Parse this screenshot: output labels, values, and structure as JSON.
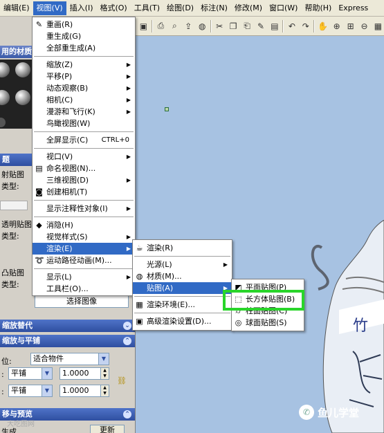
{
  "menubar": {
    "items": [
      "编辑(E)",
      "视图(V)",
      "插入(I)",
      "格式(O)",
      "工具(T)",
      "绘图(D)",
      "标注(N)",
      "修改(M)",
      "窗口(W)",
      "帮助(H)",
      "Express"
    ]
  },
  "view_menu": {
    "items": [
      {
        "label": "重画(R)"
      },
      {
        "label": "重生成(G)"
      },
      {
        "label": "全部重生成(A)"
      },
      {
        "label": "缩放(Z)"
      },
      {
        "label": "平移(P)"
      },
      {
        "label": "动态观察(B)"
      },
      {
        "label": "相机(C)"
      },
      {
        "label": "漫游和飞行(K)"
      },
      {
        "label": "鸟瞰视图(W)"
      },
      {
        "label": "全屏显示(C)",
        "shortcut": "CTRL+0"
      },
      {
        "label": "视口(V)"
      },
      {
        "label": "命名视图(N)..."
      },
      {
        "label": "三维视图(D)"
      },
      {
        "label": "创建相机(T)"
      },
      {
        "label": "显示注释性对象(I)"
      },
      {
        "label": "消隐(H)"
      },
      {
        "label": "视觉样式(S)"
      },
      {
        "label": "渲染(E)"
      },
      {
        "label": "运动路径动画(M)..."
      },
      {
        "label": "显示(L)"
      },
      {
        "label": "工具栏(O)..."
      }
    ]
  },
  "render_menu": {
    "items": [
      {
        "label": "渲染(R)"
      },
      {
        "label": "光源(L)"
      },
      {
        "label": "材质(M)..."
      },
      {
        "label": "贴图(A)"
      },
      {
        "label": "渲染环境(E)..."
      },
      {
        "label": "高级渲染设置(D)..."
      }
    ]
  },
  "mapping_menu": {
    "items": [
      {
        "label": "平面贴图(P)"
      },
      {
        "label": "长方体贴图(B)"
      },
      {
        "label": "柱面贴图(C)"
      },
      {
        "label": "球面贴图(S)"
      }
    ]
  },
  "palette": {
    "head": "用的材质",
    "section_label": "题",
    "labels": [
      "射贴图",
      "类型:",
      "透明贴图",
      "类型:",
      "凸贴图",
      "类型:"
    ],
    "select_image_button": "选择图像",
    "material_scaling_bar": "缩放替代",
    "scaling_tiling_bar": "缩放与平铺",
    "position_label": "位:",
    "position_value": "适合物件",
    "tile_u": "平铺",
    "tile_v": "平铺",
    "u_value": "1.0000",
    "v_value": "1.0000",
    "preview_bar": "移与预览",
    "update_button": "更新",
    "bottom_label": "生成"
  },
  "watermark": {
    "text": "鱼儿学堂"
  },
  "footer_mark": {
    "text": "大吃图网"
  }
}
